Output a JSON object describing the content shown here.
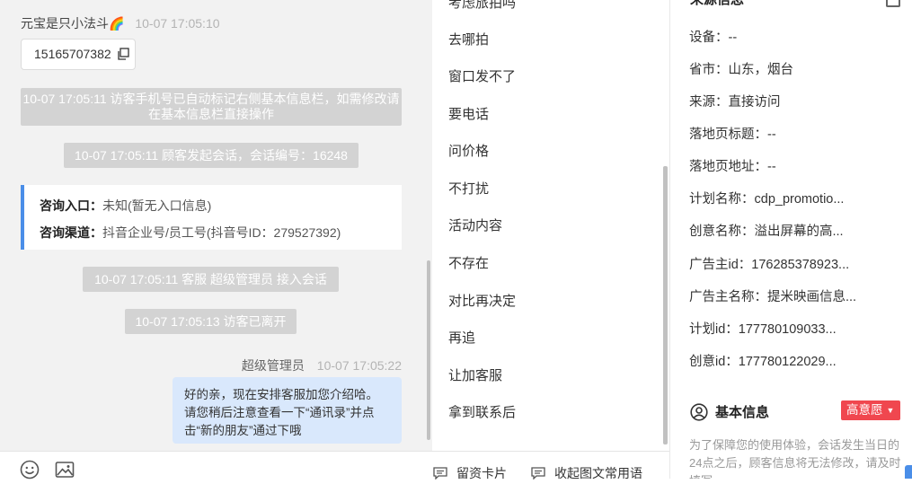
{
  "chat": {
    "sender_name": "元宝是只小法斗🌈",
    "sender_time": "10-07 17:05:10",
    "phone": "15165707382",
    "sys_msgs": [
      "10-07 17:05:11 访客手机号已自动标记右侧基本信息栏，如需修改请在基本信息栏直接操作",
      "10-07 17:05:11 顾客发起会话，会话编号：16248",
      "10-07 17:05:11 客服 超级管理员 接入会话",
      "10-07 17:05:13 访客已离开"
    ],
    "consult": {
      "entry_label": "咨询入口：",
      "entry_value": "未知(暂无入口信息)",
      "channel_label": "咨询渠道：",
      "channel_value": "抖音企业号/员工号(抖音号ID：279527392)"
    },
    "agent_name": "超级管理员",
    "agent_time": "10-07 17:05:22",
    "agent_msg": "好的亲，现在安排客服加您介绍哈。请您稍后注意查看一下“通讯录”并点击“新的朋友”通过下哦"
  },
  "toolbar": {
    "emoji_icon": "smiley-icon",
    "image_icon": "image-icon",
    "card_label": "留资卡片",
    "quick_label": "收起图文常用语"
  },
  "quick_replies": [
    "考虑旅拍吗",
    "去哪拍",
    "窗口发不了",
    "要电话",
    "问价格",
    "不打扰",
    "活动内容",
    "不存在",
    "对比再决定",
    "再追",
    "让加客服",
    "拿到联系后"
  ],
  "info": {
    "source_title": "来源信息",
    "rows": [
      "设备：--",
      "省市：山东，烟台",
      "来源：直接访问",
      "落地页标题：--",
      "落地页地址：--",
      "计划名称：cdp_promotio...",
      "创意名称：溢出屏幕的高...",
      "广告主id：176285378923...",
      "广告主名称：提米映画信息...",
      "计划id：177780109033...",
      "创意id：177780122029..."
    ],
    "basic_title": "基本信息",
    "intent_badge": "高意愿",
    "notice": "为了保障您的使用体验，会话发生当日的24点之后，顾客信息将无法修改，请及时填写"
  },
  "colors": {
    "accent_blue": "#4a8ee8",
    "agent_bubble": "#d9e8fc",
    "system_msg_bg": "#d3d3d3",
    "badge_red": "#f0474f"
  }
}
